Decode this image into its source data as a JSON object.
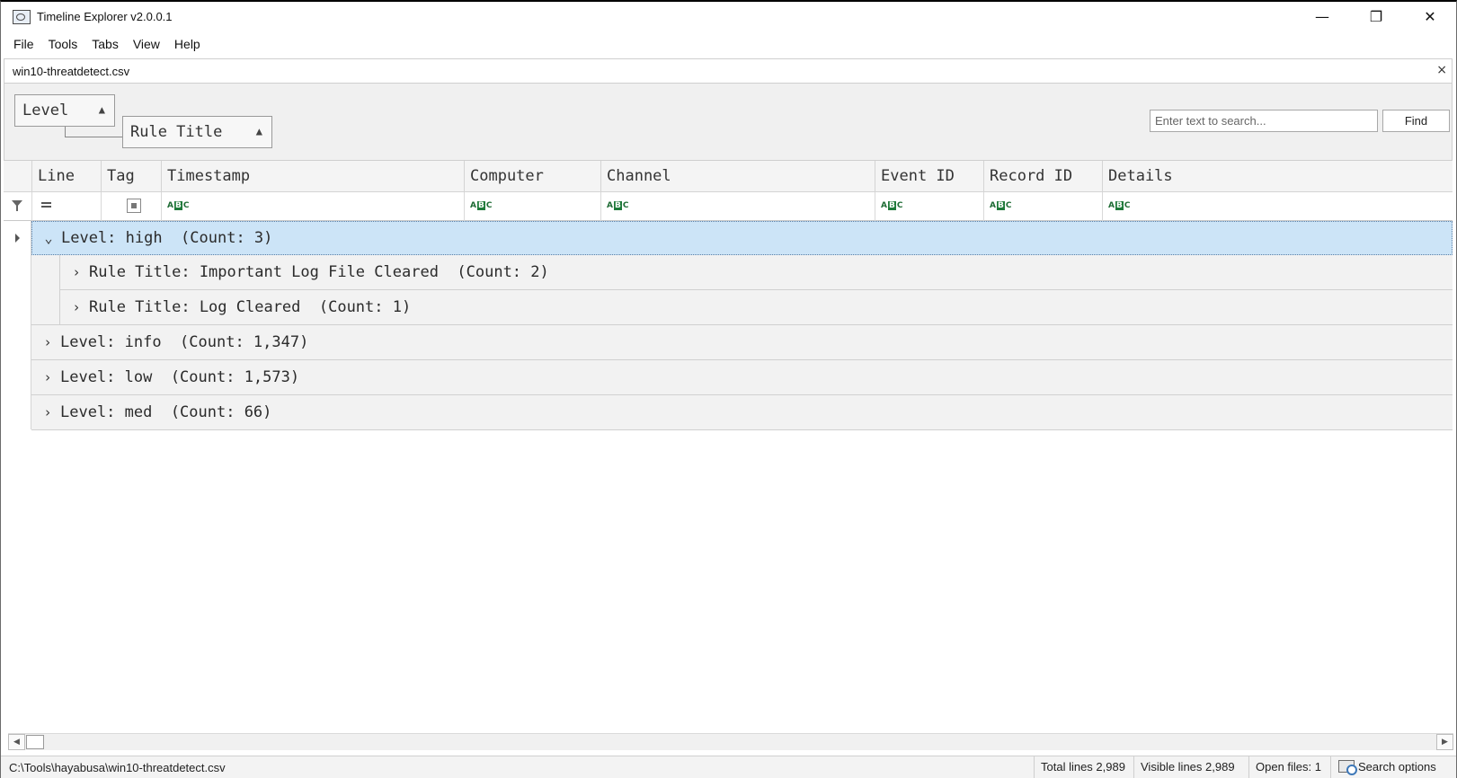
{
  "window": {
    "title": "Timeline Explorer v2.0.0.1",
    "min_glyph": "—",
    "max_glyph": "❐",
    "close_glyph": "✕"
  },
  "menu": [
    "File",
    "Tools",
    "Tabs",
    "View",
    "Help"
  ],
  "tab": {
    "label": "win10-threatdetect.csv",
    "close_glyph": "×"
  },
  "group_panel": {
    "chips": [
      "Level",
      "Rule Title"
    ],
    "search_placeholder": "Enter text to search...",
    "find_label": "Find"
  },
  "columns": [
    "Line",
    "Tag",
    "Timestamp",
    "Computer",
    "Channel",
    "Event ID",
    "Record ID",
    "Details"
  ],
  "filter_icons": {
    "line": "equals-icon",
    "tag": "checkbox-icon",
    "text_columns": "abc-text-filter-icon"
  },
  "abc_icon": {
    "left": "A",
    "mid": "B",
    "right": "C"
  },
  "groups": [
    {
      "label": "Level: high  (Count: 3)",
      "expanded": true,
      "selected": true,
      "children": [
        {
          "label": "Rule Title: Important Log File Cleared  (Count: 2)"
        },
        {
          "label": "Rule Title: Log Cleared  (Count: 1)"
        }
      ]
    },
    {
      "label": "Level: info  (Count: 1,347)",
      "expanded": false
    },
    {
      "label": "Level: low  (Count: 1,573)",
      "expanded": false
    },
    {
      "label": "Level: med  (Count: 66)",
      "expanded": false
    }
  ],
  "chevrons": {
    "expanded": "⌄",
    "collapsed": "›"
  },
  "status": {
    "path": "C:\\Tools\\hayabusa\\win10-threatdetect.csv",
    "total_lines": "Total lines 2,989",
    "visible_lines": "Visible lines 2,989",
    "open_files": "Open files: 1",
    "search_options": "Search options"
  },
  "colors": {
    "selected_row": "#cce4f7",
    "group_row": "#f2f2f2",
    "abc_icon_green": "#1f7a3a"
  }
}
